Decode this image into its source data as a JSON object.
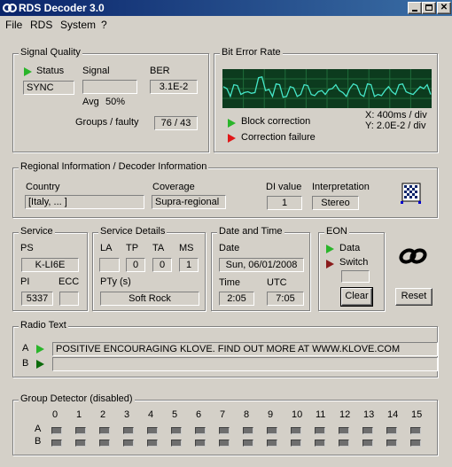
{
  "window": {
    "title": "RDS Decoder 3.0"
  },
  "menu": {
    "file": "File",
    "rds": "RDS",
    "system": "System",
    "help": "?"
  },
  "signal_quality": {
    "title": "Signal Quality",
    "status_label": "Status",
    "status_value": "SYNC",
    "signal_label": "Signal",
    "avg_label": "Avg",
    "avg_value": "50%",
    "ber_label": "BER",
    "ber_value": "3.1E-2",
    "groups_label": "Groups / faulty",
    "groups_value": "76 / 43"
  },
  "ber_panel": {
    "title": "Bit Error Rate",
    "legend_ok": "Block correction",
    "legend_fail": "Correction failure",
    "scale_x": "X: 400ms / div",
    "scale_y": "Y: 2.0E-2 / div",
    "trace": [
      0.55,
      0.5,
      0.3,
      0.6,
      0.58,
      0.35,
      0.4,
      0.42,
      0.38,
      0.4,
      0.78,
      0.8,
      0.45,
      0.48,
      0.3,
      0.62,
      0.6,
      0.28,
      0.3,
      0.55,
      0.52,
      0.3,
      0.35,
      0.6,
      0.58,
      0.35,
      0.32,
      0.42,
      0.45,
      0.35,
      0.48,
      0.5,
      0.6,
      0.45,
      0.4,
      0.3,
      0.5,
      0.62,
      0.58,
      0.35,
      0.3,
      0.62,
      0.6,
      0.3,
      0.35,
      0.32,
      0.45,
      0.55,
      0.42,
      0.35,
      0.6,
      0.62,
      0.42,
      0.38,
      0.35,
      0.45,
      0.55,
      0.5,
      0.6,
      0.35
    ]
  },
  "regional": {
    "title": "Regional Information / Decoder Information",
    "country_label": "Country",
    "country_value": "[Italy, ... ]",
    "coverage_label": "Coverage",
    "coverage_value": "Supra-regional",
    "di_label": "DI value",
    "di_value": "1",
    "interp_label": "Interpretation",
    "interp_value": "Stereo"
  },
  "service": {
    "title": "Service",
    "ps_label": "PS",
    "ps_value": "K-LI6E",
    "pi_label": "PI",
    "pi_value": "5337",
    "ecc_label": "ECC",
    "ecc_value": ""
  },
  "service_details": {
    "title": "Service Details",
    "la_label": "LA",
    "tp_label": "TP",
    "ta_label": "TA",
    "ms_label": "MS",
    "la_value": "",
    "tp_value": "0",
    "ta_value": "0",
    "ms_value": "1",
    "pty_label": "PTy (s)",
    "pty_value": "Soft Rock"
  },
  "datetime": {
    "title": "Date and Time",
    "date_label": "Date",
    "date_value": "Sun, 06/01/2008",
    "time_label": "Time",
    "time_value": "2:05",
    "utc_label": "UTC",
    "utc_value": "7:05"
  },
  "eon": {
    "title": "EON",
    "data_label": "Data",
    "switch_label": "Switch",
    "switch_value": "",
    "clear_label": "Clear"
  },
  "reset_label": "Reset",
  "radio_text": {
    "title": "Radio Text",
    "a_label": "A",
    "b_label": "B",
    "a_value": "POSITIVE ENCOURAGING KLOVE. FIND OUT MORE AT WWW.KLOVE.COM",
    "b_value": ""
  },
  "group_detector": {
    "title": "Group Detector (disabled)",
    "columns": [
      "0",
      "1",
      "2",
      "3",
      "4",
      "5",
      "6",
      "7",
      "8",
      "9",
      "10",
      "11",
      "12",
      "13",
      "14",
      "15"
    ],
    "rows": [
      "A",
      "B"
    ]
  },
  "colors": {
    "scope_bg": "#0c3b1e",
    "scope_grid": "#1f6b3a",
    "scope_trace": "#45e6c8",
    "ok": "#2ab52a",
    "fail": "#e01818"
  }
}
